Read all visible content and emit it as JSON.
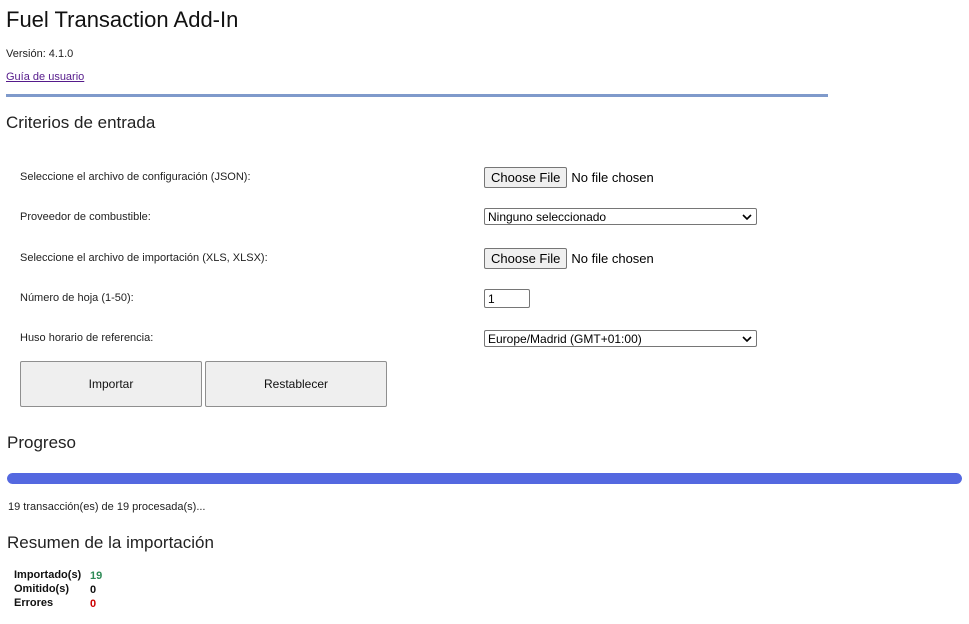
{
  "app": {
    "title": "Fuel Transaction Add-In",
    "version": "Versión: 4.1.0",
    "user_guide_link": "Guía de usuario"
  },
  "input_criteria": {
    "title": "Criterios de entrada",
    "config_file": {
      "label": "Seleccione el archivo de configuración (JSON):",
      "button": "Choose File",
      "status": "No file chosen"
    },
    "fuel_provider": {
      "label": "Proveedor de combustible:",
      "selected": "Ninguno seleccionado"
    },
    "import_file": {
      "label": "Seleccione el archivo de importación (XLS, XLSX):",
      "button": "Choose File",
      "status": "No file chosen"
    },
    "sheet_number": {
      "label": "Número de hoja (1-50):",
      "value": "1"
    },
    "timezone": {
      "label": "Huso horario de referencia:",
      "selected": "Europe/Madrid (GMT+01:00)"
    },
    "import_button": "Importar",
    "reset_button": "Restablecer"
  },
  "progress": {
    "title": "Progreso",
    "fraction": 1.0,
    "status_text": "19 transacción(es) de 19 procesada(s)..."
  },
  "summary": {
    "title": "Resumen de la importación",
    "rows": [
      {
        "label": "Importado(s)",
        "value": "19",
        "color": "#2e8b57"
      },
      {
        "label": "Omitido(s)",
        "value": "0",
        "color": "#111111"
      },
      {
        "label": "Errores",
        "value": "0",
        "color": "#cc0000"
      }
    ]
  },
  "colors": {
    "accent_rule": "#7f9acb",
    "progress_fill": "#5468e0",
    "link": "#551a8b"
  },
  "icons": {
    "select_arrow": "chevron-down-icon"
  }
}
